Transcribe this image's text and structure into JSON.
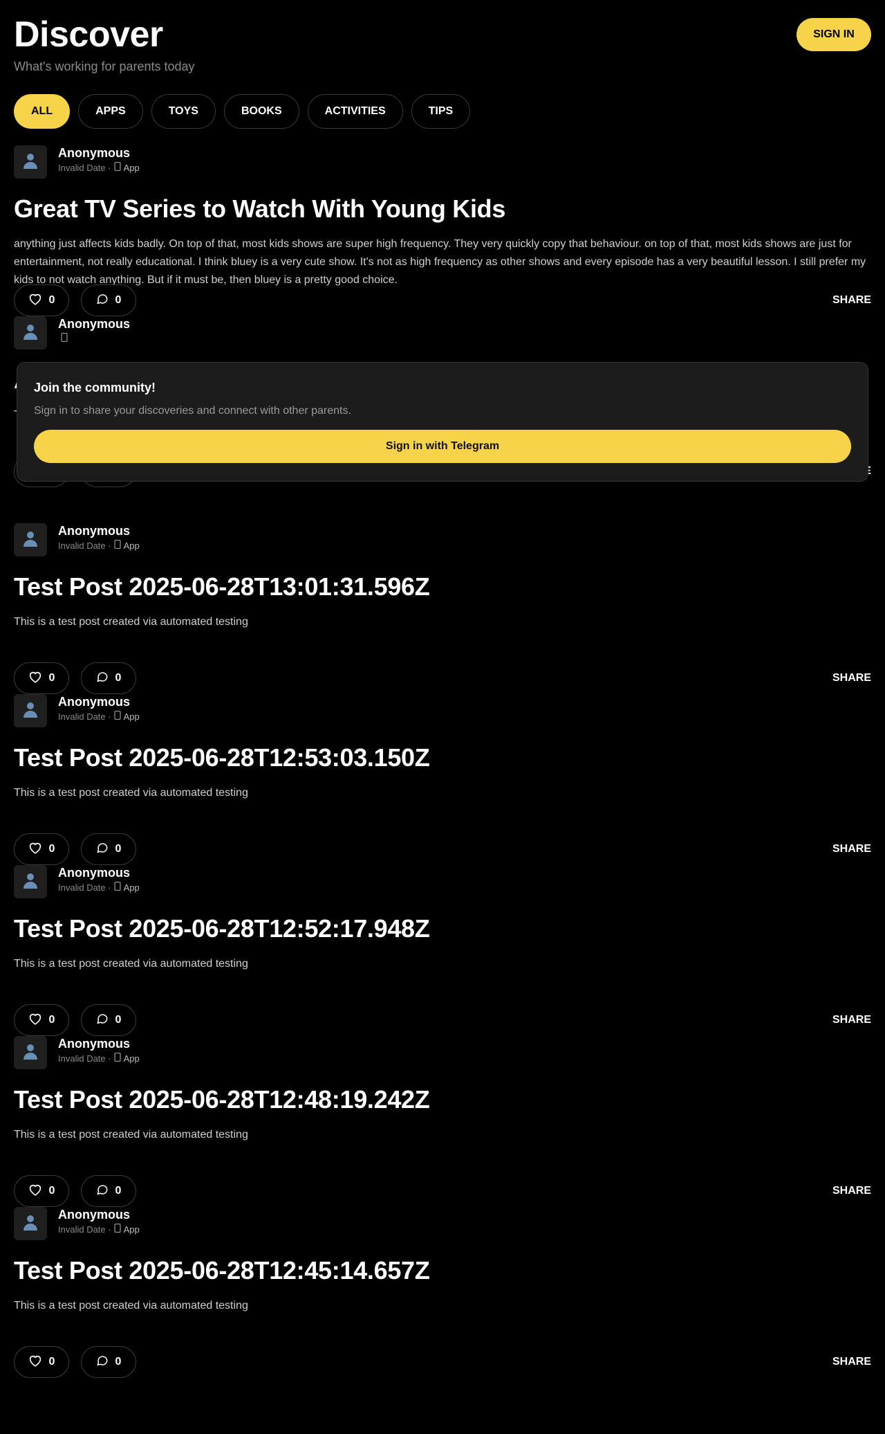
{
  "header": {
    "title": "Discover",
    "subtitle": "What's working for parents today",
    "sign_in_label": "SIGN IN"
  },
  "filters": [
    {
      "label": "ALL",
      "active": true
    },
    {
      "label": "APPS",
      "active": false
    },
    {
      "label": "TOYS",
      "active": false
    },
    {
      "label": "BOOKS",
      "active": false
    },
    {
      "label": "ACTIVITIES",
      "active": false
    },
    {
      "label": "TIPS",
      "active": false
    }
  ],
  "posts": [
    {
      "author": "Anonymous",
      "date": "Invalid Date ·",
      "category": "App",
      "title": "Great TV Series to Watch With Young Kids",
      "body": "anything just affects kids badly. On top of that, most kids shows are super high frequency. They very quickly copy that behaviour. on top of that, most kids shows are just for entertainment, not really educational. I think bluey is a very cute show. It's not as high frequency as other shows and every episode has a very beautiful lesson. I still prefer my kids to not watch anything. But if it must be, then bluey is a pretty good choice.",
      "likes": "0",
      "comments": "0",
      "share": "SHARE"
    },
    {
      "author": "Anonymous",
      "date": "",
      "category": "",
      "title": "A",
      "body": "T",
      "likes": "0",
      "comments": "0",
      "share": "SHARE"
    },
    {
      "author": "Anonymous",
      "date": "Invalid Date ·",
      "category": "App",
      "title": "Test Post 2025-06-28T13:01:31.596Z",
      "body": "This is a test post created via automated testing",
      "likes": "0",
      "comments": "0",
      "share": "SHARE"
    },
    {
      "author": "Anonymous",
      "date": "Invalid Date ·",
      "category": "App",
      "title": "Test Post 2025-06-28T12:53:03.150Z",
      "body": "This is a test post created via automated testing",
      "likes": "0",
      "comments": "0",
      "share": "SHARE"
    },
    {
      "author": "Anonymous",
      "date": "Invalid Date ·",
      "category": "App",
      "title": "Test Post 2025-06-28T12:52:17.948Z",
      "body": "This is a test post created via automated testing",
      "likes": "0",
      "comments": "0",
      "share": "SHARE"
    },
    {
      "author": "Anonymous",
      "date": "Invalid Date ·",
      "category": "App",
      "title": "Test Post 2025-06-28T12:48:19.242Z",
      "body": "This is a test post created via automated testing",
      "likes": "0",
      "comments": "0",
      "share": "SHARE"
    },
    {
      "author": "Anonymous",
      "date": "Invalid Date ·",
      "category": "App",
      "title": "Test Post 2025-06-28T12:45:14.657Z",
      "body": "This is a test post created via automated testing",
      "likes": "0",
      "comments": "0",
      "share": "SHARE"
    }
  ],
  "join_prompt": {
    "title": "Join the community!",
    "text": "Sign in to share your discoveries and connect with other parents.",
    "button_label": "Sign in with Telegram"
  },
  "colors": {
    "accent": "#f6d349",
    "background": "#000000",
    "card": "#1c1c1c"
  },
  "icons": {
    "avatar": "person-silhouette-icon",
    "category": "phone-icon",
    "like": "heart-icon",
    "comment": "comment-bubble-icon"
  }
}
